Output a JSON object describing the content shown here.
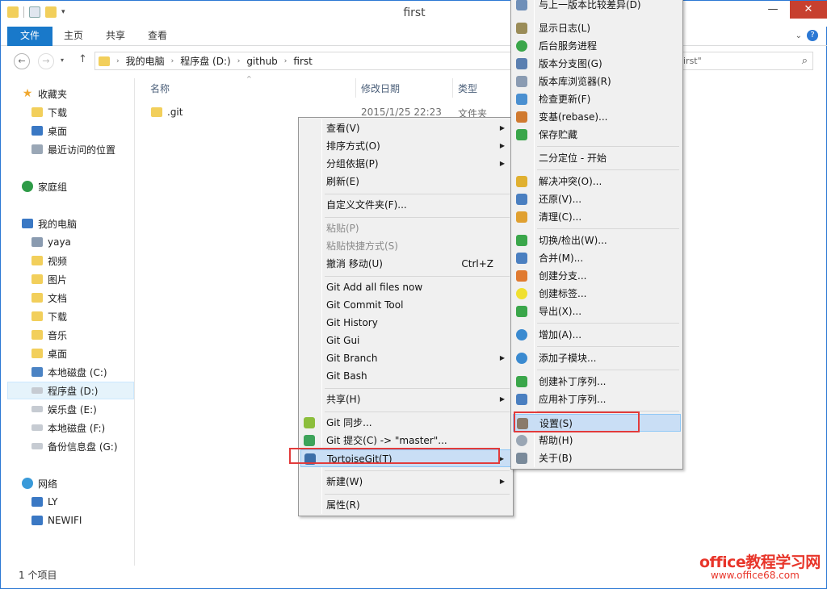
{
  "window": {
    "title": "first",
    "ribbon_tabs": [
      "文件",
      "主页",
      "共享",
      "查看"
    ],
    "controls": {
      "minimize": "—",
      "maximize": "☐",
      "close": "✕"
    }
  },
  "address": {
    "crumbs": [
      "我的电脑",
      "程序盘 (D:)",
      "github",
      "first"
    ],
    "search_text": "irst\""
  },
  "sidebar": {
    "favorites_header": "收藏夹",
    "favorites": [
      "下载",
      "桌面",
      "最近访问的位置"
    ],
    "homegroup": "家庭组",
    "pc_header": "我的电脑",
    "pc_items": [
      "yaya",
      "视频",
      "图片",
      "文档",
      "下载",
      "音乐",
      "桌面",
      "本地磁盘 (C:)",
      "程序盘 (D:)",
      "娱乐盘 (E:)",
      "本地磁盘 (F:)",
      "备份信息盘 (G:)"
    ],
    "network_header": "网络",
    "network_items": [
      "LY",
      "NEWIFI"
    ]
  },
  "columns": {
    "name": "名称",
    "date": "修改日期",
    "type": "类型"
  },
  "files": [
    {
      "name": ".git",
      "date": "2015/1/25 22:23",
      "type": "文件夹"
    }
  ],
  "status": "1 个项目",
  "context_menu": {
    "items": [
      "查看(V)",
      "排序方式(O)",
      "分组依据(P)",
      "刷新(E)",
      "自定义文件夹(F)...",
      "粘贴(P)",
      "粘贴快捷方式(S)",
      "撤消 移动(U)",
      "Git Add all files now",
      "Git Commit Tool",
      "Git History",
      "Git Gui",
      "Git Branch",
      "Git Bash",
      "共享(H)",
      "Git 同步...",
      "Git 提交(C) -> \"master\"...",
      "TortoiseGit(T)",
      "新建(W)",
      "属性(R)"
    ],
    "undo_shortcut": "Ctrl+Z"
  },
  "tortoise_menu": {
    "items": [
      "与上一版本比较差异(D)",
      "显示日志(L)",
      "后台服务进程",
      "版本分支图(G)",
      "版本库浏览器(R)",
      "检查更新(F)",
      "变基(rebase)...",
      "保存贮藏",
      "二分定位 - 开始",
      "解决冲突(O)...",
      "还原(V)...",
      "清理(C)...",
      "切换/检出(W)...",
      "合并(M)...",
      "创建分支...",
      "创建标签...",
      "导出(X)...",
      "增加(A)...",
      "添加子模块...",
      "创建补丁序列...",
      "应用补丁序列...",
      "设置(S)",
      "帮助(H)",
      "关于(B)"
    ]
  },
  "watermark": {
    "line1": "office教程学习网",
    "line2": "www.office68.com"
  }
}
